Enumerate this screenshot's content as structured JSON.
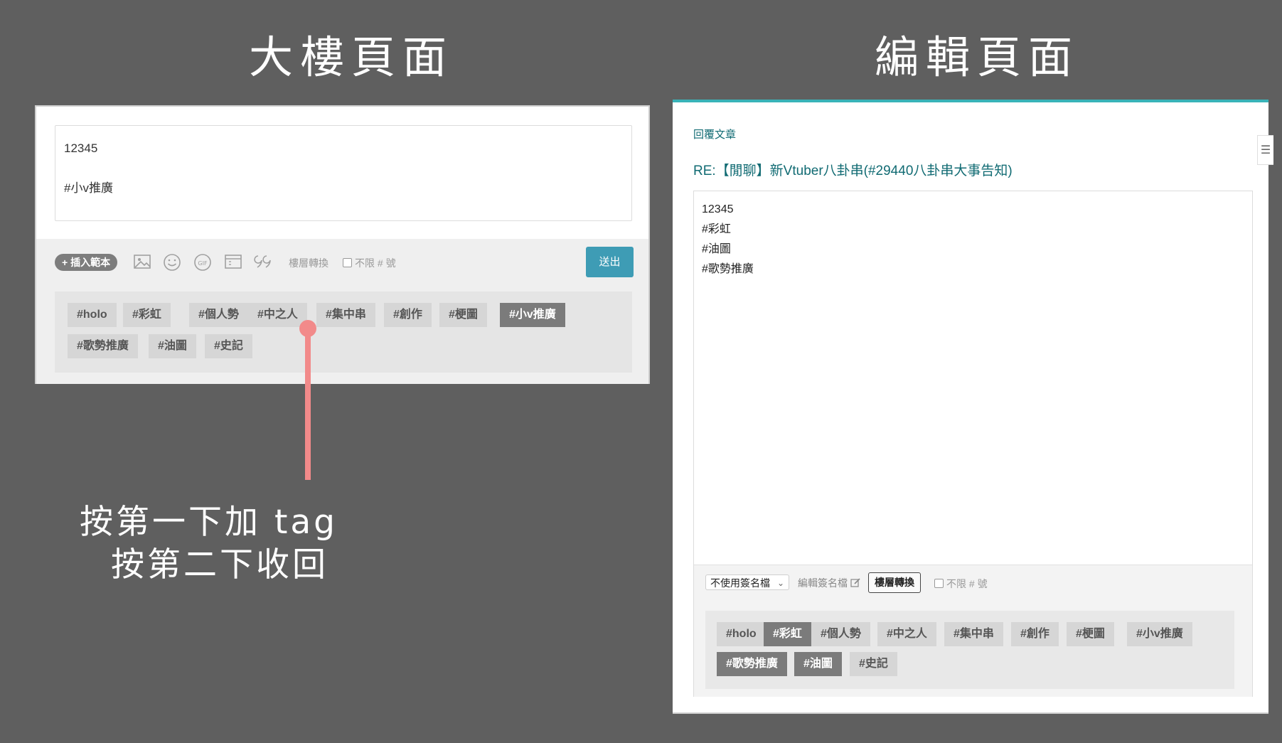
{
  "headings": {
    "left": "大樓頁面",
    "right": "編輯頁面"
  },
  "left_panel": {
    "textbox_lines": [
      "12345",
      "",
      "#小v推廣"
    ],
    "toolbar": {
      "insert_template": "+ 插入範本",
      "icons": [
        "image-icon",
        "emoji-icon",
        "gif-icon",
        "calendar-icon",
        "quote-icon"
      ],
      "floor_convert": "樓層轉換",
      "unlimited_hash": "不限 # 號",
      "send": "送出"
    },
    "tags": [
      {
        "label": "#holo",
        "active": false
      },
      {
        "label": "#彩虹",
        "active": false
      },
      {
        "label": "#個人勢",
        "active": false
      },
      {
        "label": "#中之人",
        "active": false
      },
      {
        "label": "#集中串",
        "active": false
      },
      {
        "label": "#創作",
        "active": false
      },
      {
        "label": "#梗圖",
        "active": false
      },
      {
        "label": "#小v推廣",
        "active": true
      },
      {
        "label": "#歌勢推廣",
        "active": false
      },
      {
        "label": "#油圖",
        "active": false
      },
      {
        "label": "#史記",
        "active": false
      }
    ]
  },
  "callout": {
    "line1": "按第一下加 tag",
    "line2": "按第二下收回",
    "color": "#f28a8a"
  },
  "right_panel": {
    "reply_label": "回覆文章",
    "title": "RE:【閒聊】新Vtuber八卦串(#29440八卦串大事告知)",
    "text_lines": [
      "12345",
      "#彩虹",
      "#油圖",
      "#歌勢推廣"
    ],
    "toolbar": {
      "signature_select": "不使用簽名檔",
      "edit_signature": "編輯簽名檔",
      "floor_convert": "樓層轉換",
      "unlimited_hash": "不限 # 號"
    },
    "tags": [
      {
        "label": "#holo",
        "active": false
      },
      {
        "label": "#彩虹",
        "active": true
      },
      {
        "label": "#個人勢",
        "active": false
      },
      {
        "label": "#中之人",
        "active": false
      },
      {
        "label": "#集中串",
        "active": false
      },
      {
        "label": "#創作",
        "active": false
      },
      {
        "label": "#梗圖",
        "active": false
      },
      {
        "label": "#小v推廣",
        "active": false
      },
      {
        "label": "#歌勢推廣",
        "active": true
      },
      {
        "label": "#油圖",
        "active": true
      },
      {
        "label": "#史記",
        "active": false
      }
    ]
  },
  "colors": {
    "background": "#5f5f5f",
    "accent_teal": "#39b3b8",
    "send_button": "#3e9cb5",
    "title_text": "#116b73",
    "tag_active": "#7b7b7b",
    "tag_inactive": "#d6d6d6"
  }
}
